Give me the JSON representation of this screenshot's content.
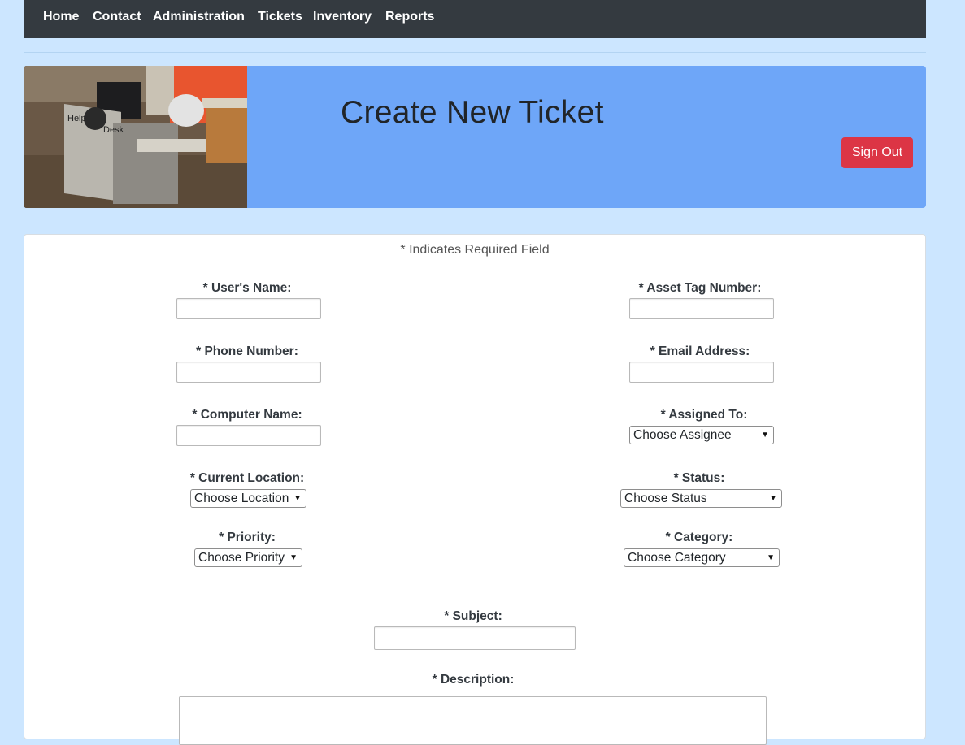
{
  "nav": {
    "items": [
      "Home",
      "Contact",
      "Administration",
      "Tickets",
      "Inventory",
      "Reports"
    ]
  },
  "header": {
    "title": "Create New Ticket",
    "signout_label": "Sign Out",
    "photo_sign_left": "Help",
    "photo_sign_right": "Desk"
  },
  "form": {
    "required_note": "* Indicates Required Field",
    "users_name_label": "* User's Name:",
    "asset_tag_label": "* Asset Tag Number:",
    "phone_label": "* Phone Number:",
    "email_label": "* Email Address:",
    "computer_name_label": "* Computer Name:",
    "assigned_to_label": "* Assigned To:",
    "assigned_to_value": "Choose Assignee",
    "location_label": "* Current Location:",
    "location_value": "Choose Location",
    "status_label": "* Status:",
    "status_value": "Choose Status",
    "priority_label": "* Priority:",
    "priority_value": "Choose Priority",
    "category_label": "* Category:",
    "category_value": "Choose Category",
    "subject_label": "* Subject:",
    "description_label": "* Description:"
  },
  "colors": {
    "background": "#cce6ff",
    "navbar": "#343a40",
    "header": "#6ea6f8",
    "signout": "#dc3545"
  }
}
